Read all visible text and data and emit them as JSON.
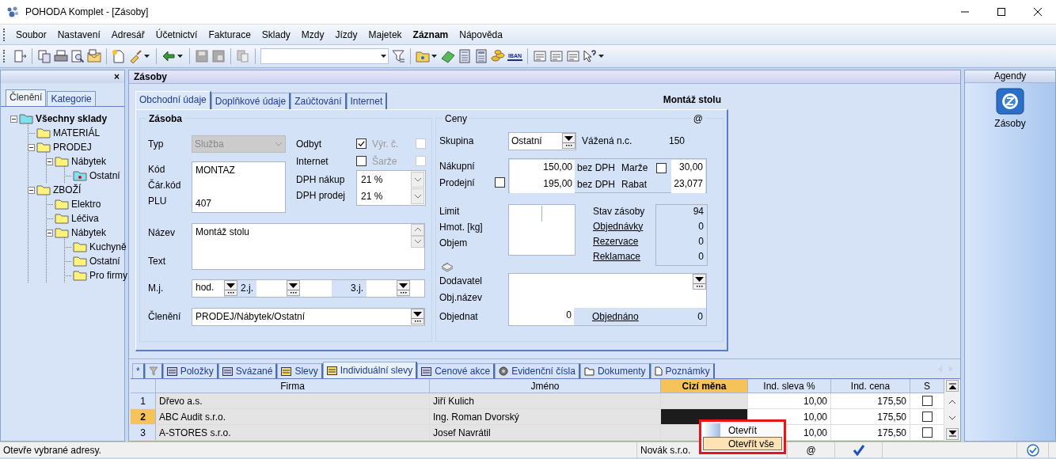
{
  "window": {
    "title": "POHODA Komplet - [Zásoby]"
  },
  "menu": [
    {
      "label": "Soubor",
      "bold": false
    },
    {
      "label": "Nastavení",
      "bold": false
    },
    {
      "label": "Adresář",
      "bold": false
    },
    {
      "label": "Účetnictví",
      "bold": false
    },
    {
      "label": "Fakturace",
      "bold": false
    },
    {
      "label": "Sklady",
      "bold": false
    },
    {
      "label": "Mzdy",
      "bold": false
    },
    {
      "label": "Jízdy",
      "bold": false
    },
    {
      "label": "Majetek",
      "bold": false
    },
    {
      "label": "Záznam",
      "bold": true
    },
    {
      "label": "Nápověda",
      "bold": false
    }
  ],
  "toolbar": {
    "iban_label": "IBAN"
  },
  "left_panel": {
    "close": "×",
    "tabs": [
      {
        "label": "Členění",
        "selected": true
      },
      {
        "label": "Kategorie",
        "selected": false
      }
    ],
    "tree": [
      {
        "label": "Všechny sklady",
        "kind": "root",
        "selected": false,
        "expanded": true,
        "children": [
          {
            "label": "MATERIÁL",
            "kind": "folder",
            "selected": false
          },
          {
            "label": "PRODEJ",
            "kind": "folder",
            "selected": false,
            "expanded": true,
            "children": [
              {
                "label": "Nábytek",
                "kind": "folder",
                "selected": false,
                "expanded": true,
                "children": [
                  {
                    "label": "Ostatní",
                    "kind": "folder",
                    "selected": true
                  }
                ]
              }
            ]
          },
          {
            "label": "ZBOŽÍ",
            "kind": "folder",
            "selected": false,
            "expanded": true,
            "children": [
              {
                "label": "Elektro",
                "kind": "folder",
                "selected": false
              },
              {
                "label": "Léčiva",
                "kind": "folder",
                "selected": false
              },
              {
                "label": "Nábytek",
                "kind": "folder",
                "selected": false,
                "expanded": true,
                "children": [
                  {
                    "label": "Kuchyně",
                    "kind": "folder",
                    "selected": false
                  },
                  {
                    "label": "Ostatní",
                    "kind": "folder",
                    "selected": false
                  },
                  {
                    "label": "Pro firmy",
                    "kind": "folder",
                    "selected": false
                  }
                ]
              }
            ]
          }
        ]
      }
    ]
  },
  "panel": {
    "title": "Zásoby",
    "record_title": "Montáž stolu"
  },
  "form_tabs": [
    {
      "label": "Obchodní údaje",
      "selected": true
    },
    {
      "label": "Doplňkové údaje",
      "selected": false
    },
    {
      "label": "Zaúčtování",
      "selected": false
    },
    {
      "label": "Internet",
      "selected": false
    }
  ],
  "zasoba": {
    "legend": "Zásoba",
    "typ": {
      "label": "Typ",
      "value": "Služba",
      "disabled": true
    },
    "odbyt": {
      "label": "Odbyt",
      "checked": true
    },
    "vyr_c": {
      "label": "Výr. č.",
      "disabled": true,
      "checked": false
    },
    "internet": {
      "label": "Internet",
      "checked": false
    },
    "sarze": {
      "label": "Šarže",
      "disabled": true,
      "checked": false
    },
    "codes": [
      {
        "label": "Kód",
        "value": "MONTAZ"
      },
      {
        "label": "Čár.kód"
      },
      {
        "label": "PLU",
        "value": "407"
      }
    ],
    "vat": [
      {
        "label": "DPH nákup",
        "value": "21 %"
      },
      {
        "label": "DPH prodej",
        "value": "21 %"
      }
    ],
    "nazev": {
      "label": "Název",
      "value": "Montáž stolu"
    },
    "text_label": "Text",
    "units": {
      "label": "M.j.",
      "unit1": "hod.",
      "unit2_label": "2.j.",
      "unit3_label": "3.j."
    },
    "cleneni": {
      "label": "Členění",
      "value": "PRODEJ/Nábytek/Ostatní"
    }
  },
  "ceny": {
    "legend": "Ceny",
    "at": "@",
    "skupina": {
      "label": "Skupina",
      "value": "Ostatní"
    },
    "vazena": {
      "label": "Vážená n.c.",
      "value": "150"
    },
    "nakupni": {
      "label": "Nákupní",
      "value": "150,00",
      "suffix": "bez DPH"
    },
    "prodejni": {
      "label": "Prodejní",
      "checked": false,
      "value": "195,00",
      "suffix": "bez DPH"
    },
    "marze": {
      "label": "Marže",
      "checked": false,
      "value": "30,00"
    },
    "rabat": {
      "label": "Rabat",
      "value": "23,077"
    },
    "measures": [
      "Limit",
      "Hmot. [kg]",
      "Objem"
    ],
    "stock": [
      {
        "label": "Stav zásoby",
        "value": "94",
        "link": false
      },
      {
        "label": "Objednávky",
        "value": "0",
        "link": true
      },
      {
        "label": "Rezervace",
        "value": "0",
        "link": true
      },
      {
        "label": "Reklamace",
        "value": "0",
        "link": true
      }
    ],
    "dodavatel_label": "Dodavatel",
    "obj_nazev_label": "Obj.název",
    "objednat": {
      "label": "Objednat",
      "value": "0"
    },
    "objednano": {
      "label": "Objednáno",
      "value": "0"
    }
  },
  "bottom_tabs": [
    {
      "label": "*",
      "selected": false
    },
    {
      "selected": false
    },
    {
      "label": "Položky",
      "selected": false
    },
    {
      "label": "Svázané",
      "selected": false
    },
    {
      "label": "Slevy",
      "selected": false
    },
    {
      "label": "Individuální slevy",
      "selected": true
    },
    {
      "label": "Cenové akce",
      "selected": false
    },
    {
      "label": "Evidenční čísla",
      "selected": false
    },
    {
      "label": "Dokumenty",
      "selected": false
    },
    {
      "label": "Poznámky",
      "selected": false
    }
  ],
  "table": {
    "columns": [
      {
        "label": "Firma",
        "selected": false
      },
      {
        "label": "Jméno",
        "selected": false
      },
      {
        "label": "Cizí měna",
        "selected": true
      },
      {
        "label": "Ind. sleva %",
        "selected": false
      },
      {
        "label": "Ind. cena",
        "selected": false
      },
      {
        "label": "S",
        "selected": false
      }
    ],
    "rows": [
      {
        "number": "1",
        "selected": false,
        "firma": "Dřevo a.s.",
        "jmeno": "Jiří Kulich",
        "ind_sleva": "10,00",
        "ind_cena": "175,50",
        "s": false
      },
      {
        "number": "2",
        "selected": true,
        "firma": "ABC Audit s.r.o.",
        "jmeno": "Ing. Roman Dvorský",
        "ind_sleva": "10,00",
        "ind_cena": "175,50",
        "s": false
      },
      {
        "number": "3",
        "selected": false,
        "firma": "A-STORES s.r.o.",
        "jmeno": "Josef Navrátil",
        "ind_sleva": "10,00",
        "ind_cena": "175,50",
        "s": false
      }
    ]
  },
  "context_menu": {
    "items": [
      {
        "label": "Otevřít",
        "selected": false
      },
      {
        "label": "Otevřít vše",
        "selected": true
      }
    ]
  },
  "right_panel": {
    "title": "Agendy",
    "items": [
      {
        "label": "Zásoby"
      }
    ]
  },
  "status_bar": {
    "hint": "Otevře vybrané adresy.",
    "company": "Novák s.r.o.",
    "at": "@"
  }
}
